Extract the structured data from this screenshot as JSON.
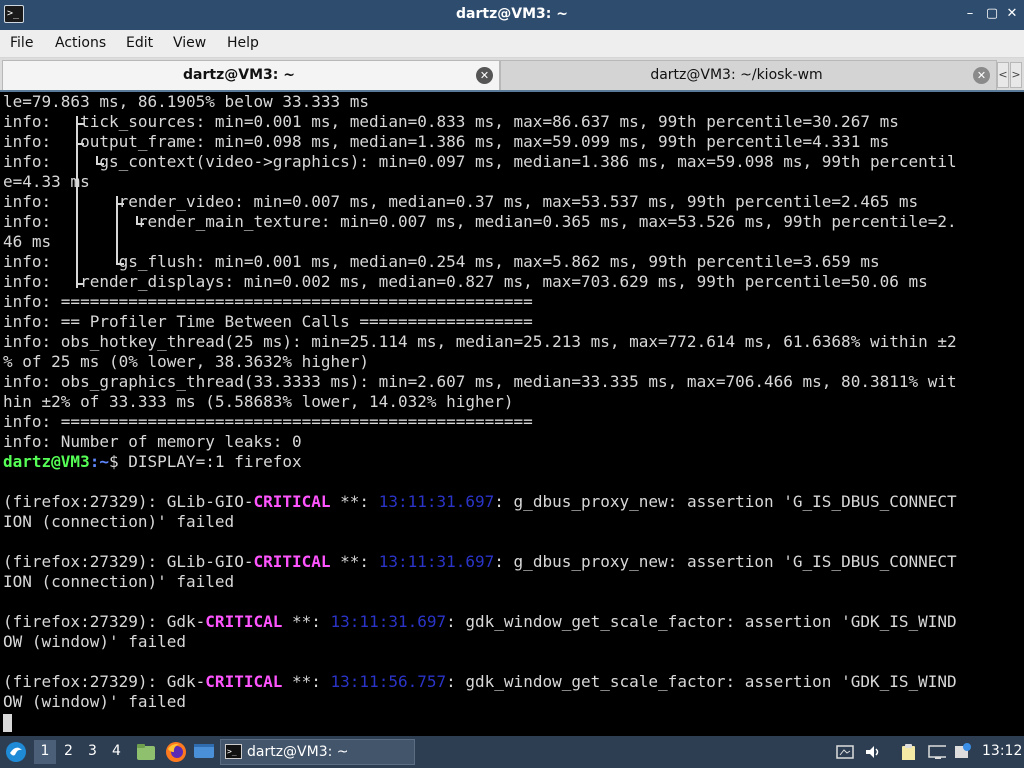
{
  "window": {
    "title": "dartz@VM3: ~",
    "minimize": "–",
    "maximize": "▢",
    "close": "✕"
  },
  "menu": {
    "file": "File",
    "actions": "Actions",
    "edit": "Edit",
    "view": "View",
    "help": "Help"
  },
  "tabs": [
    {
      "label": "dartz@VM3: ~"
    },
    {
      "label": "dartz@VM3: ~/kiosk-wm"
    }
  ],
  "terminal": {
    "lines": [
      "le=79.863 ms, 86.1905% below 33.333 ms",
      "info:   tick_sources: min=0.001 ms, median=0.833 ms, max=86.637 ms, 99th percentile=30.267 ms",
      "info:   output_frame: min=0.098 ms, median=1.386 ms, max=59.099 ms, 99th percentile=4.331 ms",
      "info:     gs_context(video->graphics): min=0.097 ms, median=1.386 ms, max=59.098 ms, 99th percentil",
      "e=4.33 ms",
      "info:       render_video: min=0.007 ms, median=0.37 ms, max=53.537 ms, 99th percentile=2.465 ms",
      "info:         render_main_texture: min=0.007 ms, median=0.365 ms, max=53.526 ms, 99th percentile=2.",
      "46 ms",
      "info:       gs_flush: min=0.001 ms, median=0.254 ms, max=5.862 ms, 99th percentile=3.659 ms",
      "info:   render_displays: min=0.002 ms, median=0.827 ms, max=703.629 ms, 99th percentile=50.06 ms",
      "info: =================================================",
      "info: == Profiler Time Between Calls ==================",
      "info: obs_hotkey_thread(25 ms): min=25.114 ms, median=25.213 ms, max=772.614 ms, 61.6368% within ±2",
      "% of 25 ms (0% lower, 38.3632% higher)",
      "info: obs_graphics_thread(33.3333 ms): min=2.607 ms, median=33.335 ms, max=706.466 ms, 80.3811% wit",
      "hin ±2% of 33.333 ms (5.58683% lower, 14.032% higher)",
      "info: =================================================",
      "info: Number of memory leaks: 0"
    ],
    "prompt_user": "dartz@VM3",
    "prompt_path": ":~",
    "prompt_cmd": "$ DISPLAY=:1 firefox",
    "errors": [
      {
        "pre": "(firefox:27329): GLib-GIO-",
        "level": "CRITICAL",
        "mid": " **: ",
        "time": "13:11:31.697",
        "msg": ": g_dbus_proxy_new: assertion 'G_IS_DBUS_CONNECT",
        "cont": "ION (connection)' failed"
      },
      {
        "pre": "(firefox:27329): GLib-GIO-",
        "level": "CRITICAL",
        "mid": " **: ",
        "time": "13:11:31.697",
        "msg": ": g_dbus_proxy_new: assertion 'G_IS_DBUS_CONNECT",
        "cont": "ION (connection)' failed"
      },
      {
        "pre": "(firefox:27329): Gdk-",
        "level": "CRITICAL",
        "mid": " **: ",
        "time": "13:11:31.697",
        "msg": ": gdk_window_get_scale_factor: assertion 'GDK_IS_WIND",
        "cont": "OW (window)' failed"
      },
      {
        "pre": "(firefox:27329): Gdk-",
        "level": "CRITICAL",
        "mid": " **: ",
        "time": "13:11:56.757",
        "msg": ": gdk_window_get_scale_factor: assertion 'GDK_IS_WIND",
        "cont": "OW (window)' failed"
      }
    ]
  },
  "taskbar": {
    "workspaces": [
      "1",
      "2",
      "3",
      "4"
    ],
    "window_label": "dartz@VM3: ~",
    "clock": "13:12"
  },
  "colors": {
    "critical": "#ff55ff",
    "timestamp": "#2b34c8",
    "prompt_user": "#55ff55",
    "prompt_path": "#5f87ff",
    "titlebar": "#2e4c6e",
    "taskbar": "#2d3e52"
  }
}
